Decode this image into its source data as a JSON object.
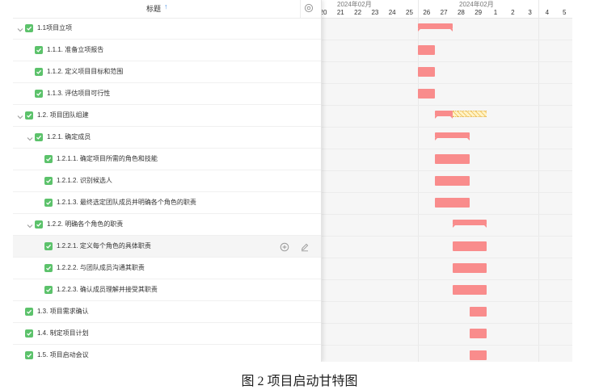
{
  "header": {
    "title": "标题",
    "sort_icon": "sort-arrow-icon",
    "settings_icon": "settings-icon"
  },
  "timeline": {
    "month_labels": [
      "2024年02月",
      "2024年02月"
    ],
    "days": [
      "20",
      "21",
      "22",
      "23",
      "24",
      "25",
      "26",
      "27",
      "28",
      "29",
      "1",
      "2",
      "3",
      "4",
      "5"
    ]
  },
  "tasks": [
    {
      "label": "1.1项目立项",
      "expanded": true,
      "done": true
    },
    {
      "label": "1.1.1. 准备立项报告",
      "done": true
    },
    {
      "label": "1.1.2. 定义项目目标和范围",
      "done": true
    },
    {
      "label": "1.1.3. 评估项目可行性",
      "done": true
    },
    {
      "label": "1.2. 项目团队组建",
      "expanded": true,
      "done": true
    },
    {
      "label": "1.2.1. 确定成员",
      "expanded": true,
      "done": true
    },
    {
      "label": "1.2.1.1. 确定项目所需的角色和技能",
      "done": true
    },
    {
      "label": "1.2.1.2. 识别候选人",
      "done": true
    },
    {
      "label": "1.2.1.3. 最终选定团队成员并明确各个角色的职责",
      "done": true
    },
    {
      "label": "1.2.2. 明确各个角色的职责",
      "expanded": true,
      "done": true
    },
    {
      "label": "1.2.2.1. 定义每个角色的具体职责",
      "done": true,
      "hovered": true
    },
    {
      "label": "1.2.2.2. 与团队成员沟通其职责",
      "done": true
    },
    {
      "label": "1.2.2.3. 确认成员理解并接受其职责",
      "done": true
    },
    {
      "label": "1.3. 项目需求确认",
      "done": true
    },
    {
      "label": "1.4. 制定项目计划",
      "done": true
    },
    {
      "label": "1.5. 项目启动会议",
      "done": true
    }
  ],
  "row_actions": {
    "add_icon": "add-circle-icon",
    "edit_icon": "edit-pencil-icon"
  },
  "gantt": {
    "bar_color": "#f98c8c",
    "slack_color": "#f3c96d",
    "bars": [
      {
        "row": 0,
        "start": "2024-02-26",
        "end": "2024-02-28",
        "type": "summary"
      },
      {
        "row": 1,
        "start": "2024-02-26",
        "end": "2024-02-27",
        "type": "task"
      },
      {
        "row": 2,
        "start": "2024-02-26",
        "end": "2024-02-27",
        "type": "task"
      },
      {
        "row": 3,
        "start": "2024-02-26",
        "end": "2024-02-27",
        "type": "task"
      },
      {
        "row": 4,
        "start": "2024-02-27",
        "end": "2024-02-28",
        "type": "summary",
        "slack_end": "2024-03-01"
      },
      {
        "row": 5,
        "start": "2024-02-27",
        "end": "2024-02-29",
        "type": "summary"
      },
      {
        "row": 6,
        "start": "2024-02-27",
        "end": "2024-02-29",
        "type": "task"
      },
      {
        "row": 7,
        "start": "2024-02-27",
        "end": "2024-02-29",
        "type": "task"
      },
      {
        "row": 8,
        "start": "2024-02-27",
        "end": "2024-02-29",
        "type": "task"
      },
      {
        "row": 9,
        "start": "2024-02-28",
        "end": "2024-03-01",
        "type": "summary"
      },
      {
        "row": 10,
        "start": "2024-02-28",
        "end": "2024-03-01",
        "type": "task"
      },
      {
        "row": 11,
        "start": "2024-02-28",
        "end": "2024-03-01",
        "type": "task"
      },
      {
        "row": 12,
        "start": "2024-02-28",
        "end": "2024-03-01",
        "type": "task"
      },
      {
        "row": 13,
        "start": "2024-02-29",
        "end": "2024-03-01",
        "type": "task"
      },
      {
        "row": 14,
        "start": "2024-02-29",
        "end": "2024-03-01",
        "type": "task"
      },
      {
        "row": 15,
        "start": "2024-02-29",
        "end": "2024-03-01",
        "type": "task"
      }
    ]
  },
  "caption": "图 2  项目启动甘特图"
}
